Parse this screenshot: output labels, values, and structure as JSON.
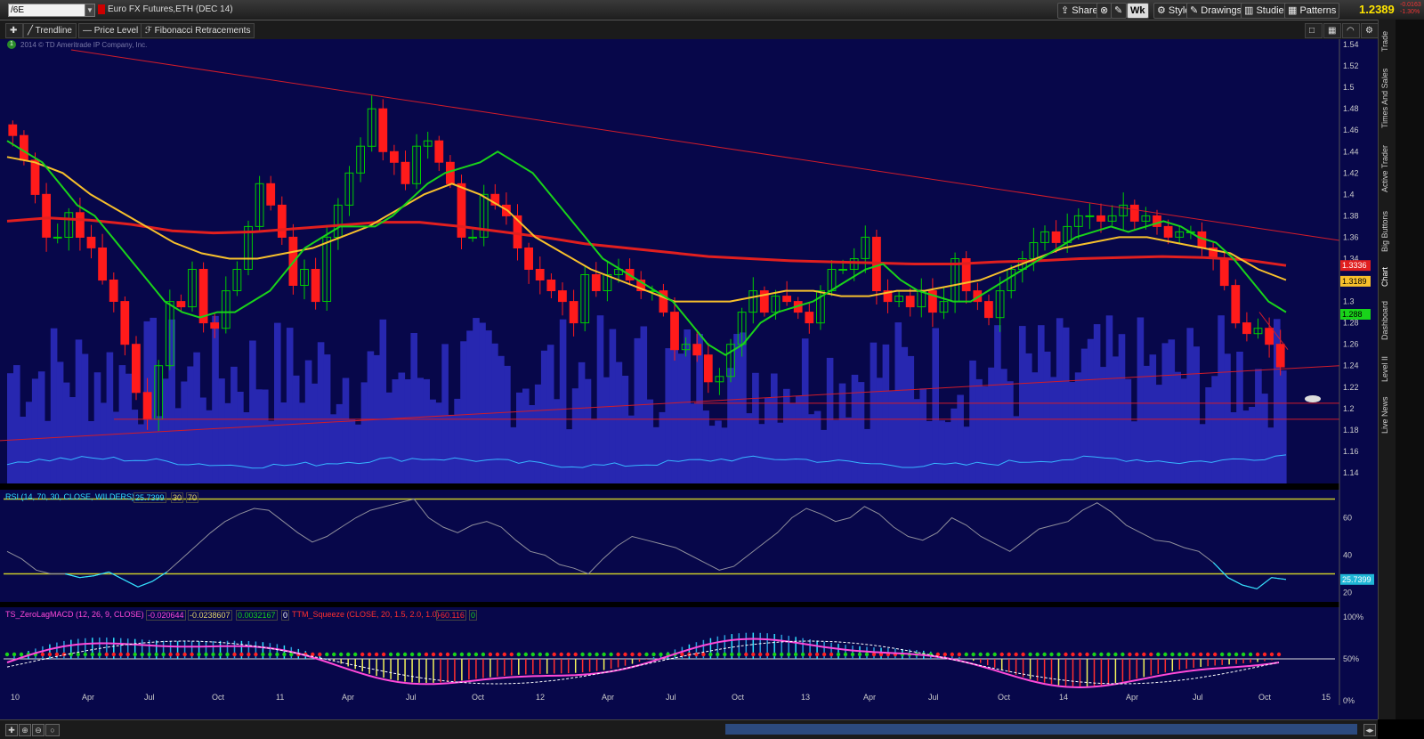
{
  "toolbar": {
    "symbol": "/6E",
    "symbol_title": "Euro FX Futures,ETH (DEC 14)",
    "share": "Share",
    "period": "Wk",
    "style": "Style",
    "drawings": "Drawings",
    "studies": "Studies",
    "patterns": "Patterns",
    "last_price": "1.2389",
    "change_abs": "-0.0163",
    "change_pct": "-1.30%"
  },
  "drawing_tools": {
    "trendline": "Trendline",
    "price_level": "Price Level",
    "fibonacci": "Fibonacci Retracements"
  },
  "watermark": "2014 © TD Ameritrade IP Company, Inc.",
  "sidebar_tabs": [
    "Trade",
    "Times And Sales",
    "Active Trader",
    "Big Buttons",
    "Chart",
    "Dashboard",
    "Level II",
    "Live News"
  ],
  "colors": {
    "background": "#07074a",
    "volume": "#2727b0",
    "up_candle": "#00cc00",
    "down_candle": "#ff1b1b",
    "sma_fast": "#19d31a",
    "sma_mid": "#f7c02c",
    "sma_slow": "#e11f1f",
    "trendline": "#d11c2a",
    "rsi_band": "#c9c92a"
  },
  "chart_data": {
    "type": "candlestick",
    "x_axis_labels": [
      "10",
      "Apr",
      "Jul",
      "Oct",
      "11",
      "Apr",
      "Jul",
      "Oct",
      "12",
      "Apr",
      "Jul",
      "Oct",
      "13",
      "Apr",
      "Jul",
      "Oct",
      "14",
      "Apr",
      "Jul",
      "Oct",
      "15"
    ],
    "price_axis": {
      "ylim": [
        1.13,
        1.545
      ],
      "ticks": [
        "1.54",
        "1.52",
        "1.5",
        "1.48",
        "1.46",
        "1.44",
        "1.42",
        "1.4",
        "1.38",
        "1.36",
        "1.34",
        "1.32",
        "1.3",
        "1.28",
        "1.26",
        "1.24",
        "1.22",
        "1.2",
        "1.18",
        "1.16",
        "1.14"
      ]
    },
    "price_closes": [
      1.455,
      1.432,
      1.4,
      1.36,
      1.36,
      1.383,
      1.36,
      1.35,
      1.32,
      1.3,
      1.26,
      1.215,
      1.19,
      1.24,
      1.3,
      1.295,
      1.33,
      1.28,
      1.275,
      1.31,
      1.33,
      1.37,
      1.41,
      1.39,
      1.36,
      1.315,
      1.33,
      1.3,
      1.36,
      1.39,
      1.42,
      1.445,
      1.48,
      1.44,
      1.43,
      1.41,
      1.445,
      1.45,
      1.43,
      1.41,
      1.36,
      1.36,
      1.4,
      1.39,
      1.38,
      1.35,
      1.33,
      1.32,
      1.31,
      1.3,
      1.28,
      1.325,
      1.31,
      1.325,
      1.33,
      1.32,
      1.31,
      1.31,
      1.29,
      1.255,
      1.26,
      1.25,
      1.225,
      1.23,
      1.26,
      1.29,
      1.31,
      1.29,
      1.305,
      1.3,
      1.29,
      1.28,
      1.31,
      1.33,
      1.33,
      1.34,
      1.36,
      1.31,
      1.3,
      1.305,
      1.295,
      1.31,
      1.29,
      1.3,
      1.34,
      1.31,
      1.3,
      1.285,
      1.31,
      1.33,
      1.34,
      1.355,
      1.365,
      1.355,
      1.37,
      1.38,
      1.38,
      1.375,
      1.38,
      1.39,
      1.375,
      1.38,
      1.37,
      1.36,
      1.365,
      1.365,
      1.35,
      1.34,
      1.315,
      1.28,
      1.27,
      1.275,
      1.26,
      1.2389
    ],
    "sma_fast": [
      1.45,
      1.44,
      1.43,
      1.41,
      1.39,
      1.38,
      1.36,
      1.34,
      1.32,
      1.3,
      1.29,
      1.285,
      1.29,
      1.29,
      1.3,
      1.31,
      1.33,
      1.35,
      1.36,
      1.37,
      1.37,
      1.37,
      1.38,
      1.395,
      1.41,
      1.42,
      1.425,
      1.43,
      1.44,
      1.43,
      1.42,
      1.4,
      1.38,
      1.36,
      1.34,
      1.33,
      1.32,
      1.31,
      1.3,
      1.28,
      1.26,
      1.25,
      1.26,
      1.28,
      1.29,
      1.295,
      1.3,
      1.31,
      1.32,
      1.33,
      1.335,
      1.32,
      1.31,
      1.305,
      1.3,
      1.3,
      1.31,
      1.32,
      1.33,
      1.34,
      1.35,
      1.36,
      1.365,
      1.37,
      1.365,
      1.37,
      1.375,
      1.37,
      1.36,
      1.355,
      1.34,
      1.32,
      1.3,
      1.29
    ],
    "sma_mid": [
      1.435,
      1.43,
      1.42,
      1.4,
      1.385,
      1.37,
      1.355,
      1.345,
      1.34,
      1.34,
      1.345,
      1.35,
      1.36,
      1.37,
      1.385,
      1.4,
      1.41,
      1.4,
      1.385,
      1.36,
      1.345,
      1.33,
      1.32,
      1.31,
      1.3,
      1.3,
      1.3,
      1.305,
      1.31,
      1.31,
      1.305,
      1.305,
      1.31,
      1.31,
      1.315,
      1.32,
      1.33,
      1.34,
      1.35,
      1.355,
      1.36,
      1.36,
      1.355,
      1.35,
      1.345,
      1.33,
      1.32
    ],
    "sma_slow": [
      1.375,
      1.378,
      1.376,
      1.372,
      1.366,
      1.364,
      1.365,
      1.368,
      1.371,
      1.374,
      1.374,
      1.37,
      1.365,
      1.36,
      1.354,
      1.35,
      1.346,
      1.342,
      1.34,
      1.338,
      1.337,
      1.336,
      1.335,
      1.335,
      1.337,
      1.338,
      1.34,
      1.341,
      1.342,
      1.341,
      1.339,
      1.3336
    ],
    "price_labels": [
      {
        "value": 1.3336,
        "text": "1.3336",
        "color": "#e11f1f"
      },
      {
        "value": 1.3189,
        "text": "1.3189",
        "color": "#f7c02c"
      },
      {
        "value": 1.288,
        "text": "1.288",
        "color": "#19d31a"
      }
    ],
    "rsi": {
      "header": "RSI (14, 70, 30, CLOSE, WILDERS)",
      "value": "25.7399",
      "oversold": "30",
      "overbought": "70",
      "ticks": [
        "60",
        "40",
        "20"
      ],
      "ylim": [
        15,
        75
      ],
      "values": [
        42,
        38,
        32,
        30,
        30,
        28,
        29,
        31,
        27,
        23,
        26,
        31,
        38,
        45,
        52,
        58,
        62,
        65,
        64,
        58,
        52,
        47,
        50,
        55,
        60,
        64,
        66,
        68,
        70,
        60,
        55,
        52,
        56,
        58,
        55,
        48,
        42,
        40,
        35,
        33,
        30,
        38,
        45,
        50,
        48,
        46,
        44,
        40,
        36,
        32,
        34,
        40,
        46,
        52,
        60,
        65,
        62,
        58,
        60,
        66,
        62,
        55,
        50,
        48,
        52,
        60,
        56,
        50,
        46,
        42,
        48,
        54,
        56,
        58,
        64,
        68,
        63,
        56,
        52,
        48,
        47,
        44,
        42,
        36,
        28,
        24,
        22,
        28,
        27
      ]
    },
    "macd": {
      "header": "TS_ZeroLagMACD (12, 26, 9, CLOSE)",
      "values": [
        "-0.020644",
        "-0.0238607",
        "0.0032167",
        "0"
      ],
      "squeeze_header": "TTM_Squeeze (CLOSE, 20, 1.5, 2.0, 1.0)",
      "squeeze_values": [
        "-60.116",
        "0"
      ],
      "ticks": [
        "100%",
        "50%",
        "0%"
      ]
    }
  }
}
